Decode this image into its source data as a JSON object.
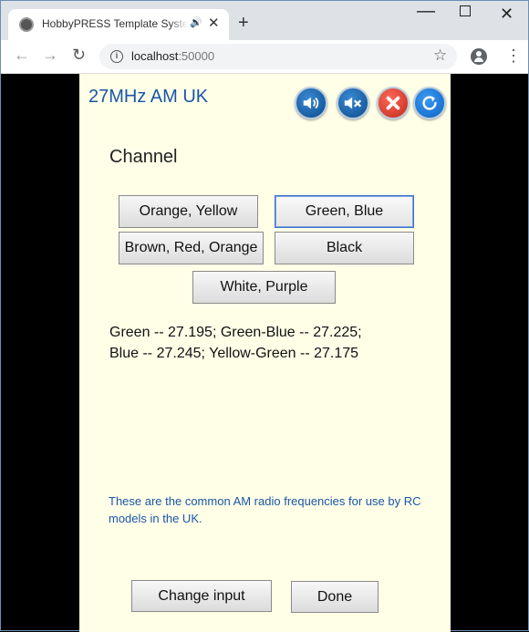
{
  "browser": {
    "tab_title": "HobbyPRESS Template System",
    "url_host": "localhost",
    "url_port": ":50000"
  },
  "app": {
    "title": "27MHz AM UK",
    "channel_label": "Channel",
    "channel_options": [
      "Orange, Yellow",
      "Green, Blue",
      "Brown, Red, Orange",
      "Black",
      "White, Purple"
    ],
    "selected_channel": "Green, Blue",
    "frequencies_line1": "Green -- 27.195; Green-Blue -- 27.225;",
    "frequencies_line2": "Blue -- 27.245; Yellow-Green -- 27.175",
    "note": "These are the common AM radio frequencies for use by RC models in the UK.",
    "change_input_label": "Change input",
    "done_label": "Done"
  },
  "icons": {
    "volume": "volume-icon",
    "mute": "mute-icon",
    "close": "close-icon",
    "refresh": "refresh-icon"
  },
  "colors": {
    "page_bg": "#ffffe8",
    "title_blue": "#1a56a8",
    "note_blue": "#1a56a8"
  }
}
